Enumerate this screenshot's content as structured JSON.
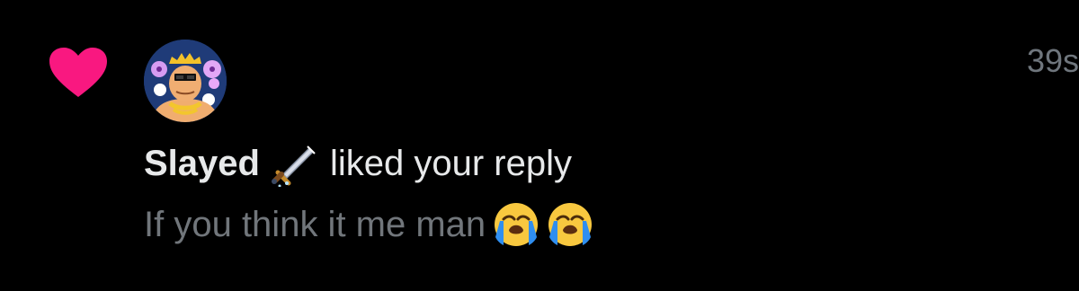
{
  "notification": {
    "type_icon": "heart-icon",
    "type_icon_color": "#f91880",
    "avatar_icon": "user-avatar",
    "username": "Slayed",
    "username_emoji": "dagger",
    "action": "liked your reply",
    "timestamp": "39s",
    "reply_text": "If you think it me man",
    "reply_emojis": [
      "loudly-crying-face",
      "loudly-crying-face"
    ]
  },
  "colors": {
    "background": "#000000",
    "primary_text": "#e7e9ea",
    "secondary_text": "#71767b",
    "like_pink": "#f91880"
  }
}
